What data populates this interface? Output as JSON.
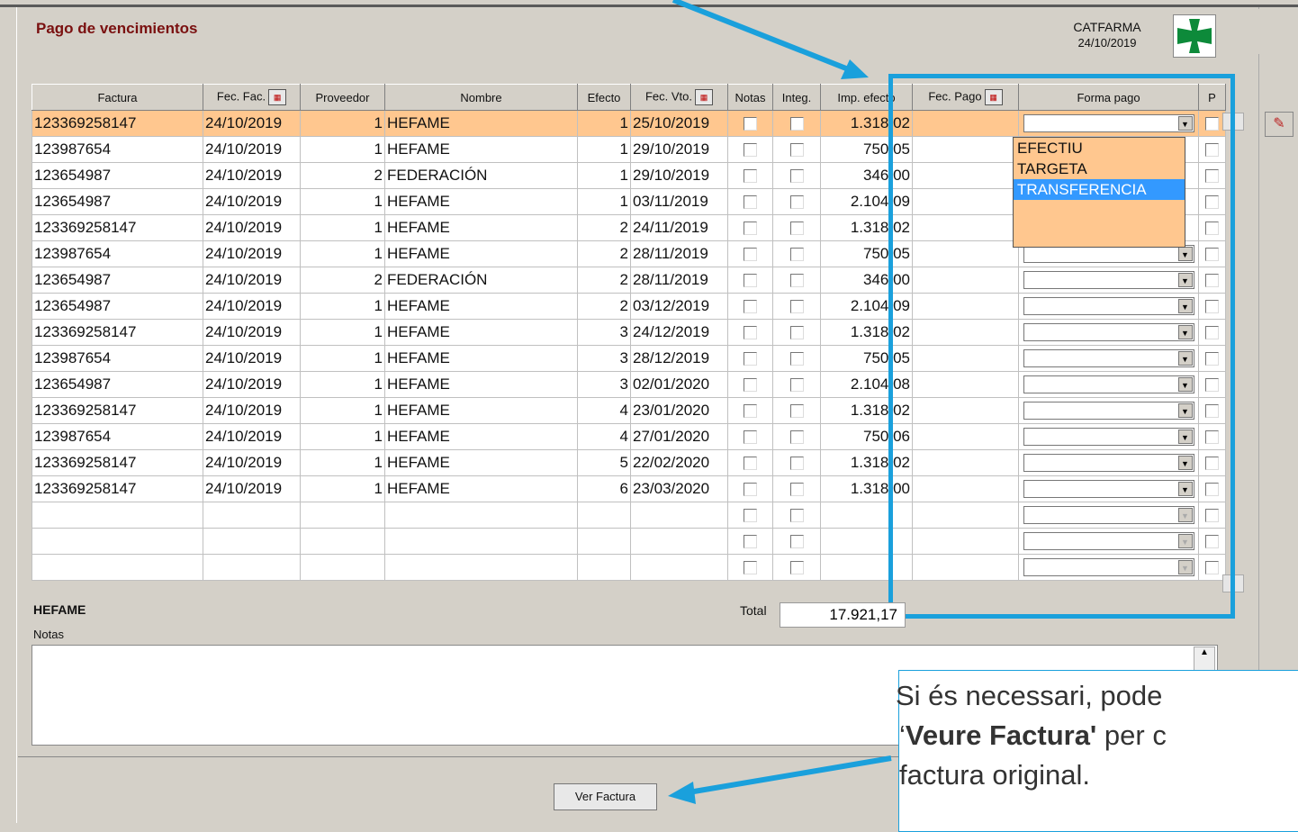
{
  "window": {
    "title": "Pago de vencimientos",
    "company": "CATFARMA",
    "date": "24/10/2019"
  },
  "columns": {
    "factura": "Factura",
    "fec_fac": "Fec. Fac.",
    "proveedor": "Proveedor",
    "nombre": "Nombre",
    "efecto": "Efecto",
    "fec_vto": "Fec. Vto.",
    "notas": "Notas",
    "integ": "Integ.",
    "imp_efecto": "Imp. efecto",
    "fec_pago": "Fec. Pago",
    "forma_pago": "Forma pago",
    "p": "P"
  },
  "rows": [
    [
      "123369258147",
      "24/10/2019",
      "1",
      "HEFAME",
      "1",
      "25/10/2019",
      "1.318,02"
    ],
    [
      "123987654",
      "24/10/2019",
      "1",
      "HEFAME",
      "1",
      "29/10/2019",
      "750,05"
    ],
    [
      "123654987",
      "24/10/2019",
      "2",
      "FEDERACIÓN",
      "1",
      "29/10/2019",
      "346,00"
    ],
    [
      "123654987",
      "24/10/2019",
      "1",
      "HEFAME",
      "1",
      "03/11/2019",
      "2.104,09"
    ],
    [
      "123369258147",
      "24/10/2019",
      "1",
      "HEFAME",
      "2",
      "24/11/2019",
      "1.318,02"
    ],
    [
      "123987654",
      "24/10/2019",
      "1",
      "HEFAME",
      "2",
      "28/11/2019",
      "750,05"
    ],
    [
      "123654987",
      "24/10/2019",
      "2",
      "FEDERACIÓN",
      "2",
      "28/11/2019",
      "346,00"
    ],
    [
      "123654987",
      "24/10/2019",
      "1",
      "HEFAME",
      "2",
      "03/12/2019",
      "2.104,09"
    ],
    [
      "123369258147",
      "24/10/2019",
      "1",
      "HEFAME",
      "3",
      "24/12/2019",
      "1.318,02"
    ],
    [
      "123987654",
      "24/10/2019",
      "1",
      "HEFAME",
      "3",
      "28/12/2019",
      "750,05"
    ],
    [
      "123654987",
      "24/10/2019",
      "1",
      "HEFAME",
      "3",
      "02/01/2020",
      "2.104,08"
    ],
    [
      "123369258147",
      "24/10/2019",
      "1",
      "HEFAME",
      "4",
      "23/01/2020",
      "1.318,02"
    ],
    [
      "123987654",
      "24/10/2019",
      "1",
      "HEFAME",
      "4",
      "27/01/2020",
      "750,06"
    ],
    [
      "123369258147",
      "24/10/2019",
      "1",
      "HEFAME",
      "5",
      "22/02/2020",
      "1.318,02"
    ],
    [
      "123369258147",
      "24/10/2019",
      "1",
      "HEFAME",
      "6",
      "23/03/2020",
      "1.318,00"
    ]
  ],
  "empty_rows": 3,
  "dropdown": {
    "options": [
      "EFECTIU",
      "TARGETA",
      "TRANSFERENCIA"
    ],
    "highlighted": "TRANSFERENCIA"
  },
  "footer": {
    "supplier_name": "HEFAME",
    "notas_label": "Notas",
    "total_label": "Total",
    "total_value": "17.921,17"
  },
  "buttons": {
    "ver_factura": "Ver Factura"
  },
  "tooltip": {
    "line1": "Si és necessari, pode",
    "line2_bold": "Veure Factura'",
    "line2_rest": " per c",
    "line3": "factura original.",
    "quote": "‘"
  },
  "colors": {
    "selected_row": "#ffc78f",
    "highlight_border": "#1aa0dc",
    "title": "#7a1010",
    "selection_blue": "#3399ff"
  }
}
